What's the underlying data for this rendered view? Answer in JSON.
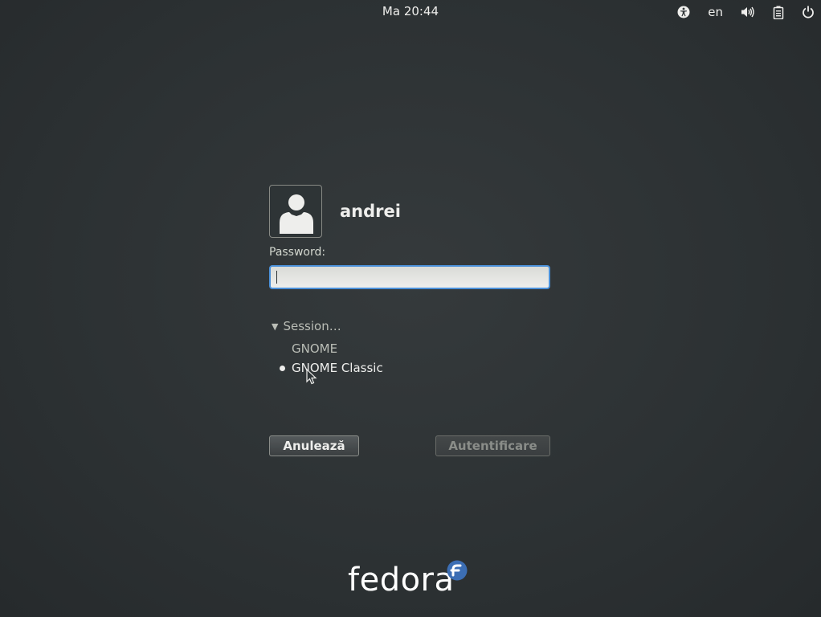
{
  "topbar": {
    "clock": "Ma 20:44",
    "language": "en",
    "icons": [
      "accessibility-icon",
      "volume-icon",
      "battery-icon",
      "power-icon"
    ]
  },
  "login": {
    "username": "andrei",
    "password_label": "Password:",
    "password_value": "",
    "session_toggle": "Session…",
    "sessions": [
      {
        "label": "GNOME",
        "selected": false
      },
      {
        "label": "GNOME Classic",
        "selected": true
      }
    ],
    "cancel_label": "Anulează",
    "login_label": "Autentificare"
  },
  "branding": {
    "logo_text": "fedora"
  },
  "colors": {
    "background": "#2e3436",
    "focus_border": "#4a90d9",
    "fedora_blue": "#294172"
  }
}
